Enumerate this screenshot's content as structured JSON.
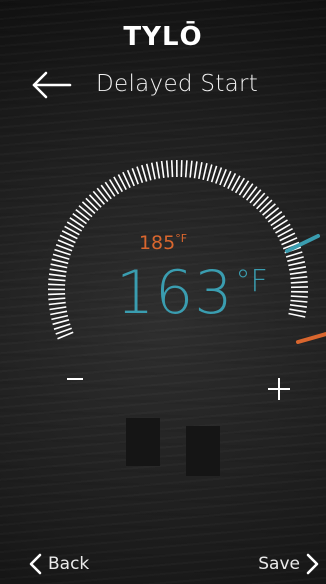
{
  "app": {
    "logo_text": "TYLŌ"
  },
  "header": {
    "title": "Delayed Start",
    "back_icon": "arrow-left-icon"
  },
  "dial": {
    "target_temp": "185",
    "target_unit": "°F",
    "current_temp": "163",
    "current_unit": "°F",
    "current_color": "#3a9db0",
    "target_color": "#d9662e",
    "tick_color": "#ffffff",
    "minus_icon": "minus-icon",
    "plus_icon": "plus-icon"
  },
  "footer": {
    "back_label": "Back",
    "save_label": "Save",
    "back_icon": "chevron-left-icon",
    "save_icon": "chevron-right-icon"
  }
}
